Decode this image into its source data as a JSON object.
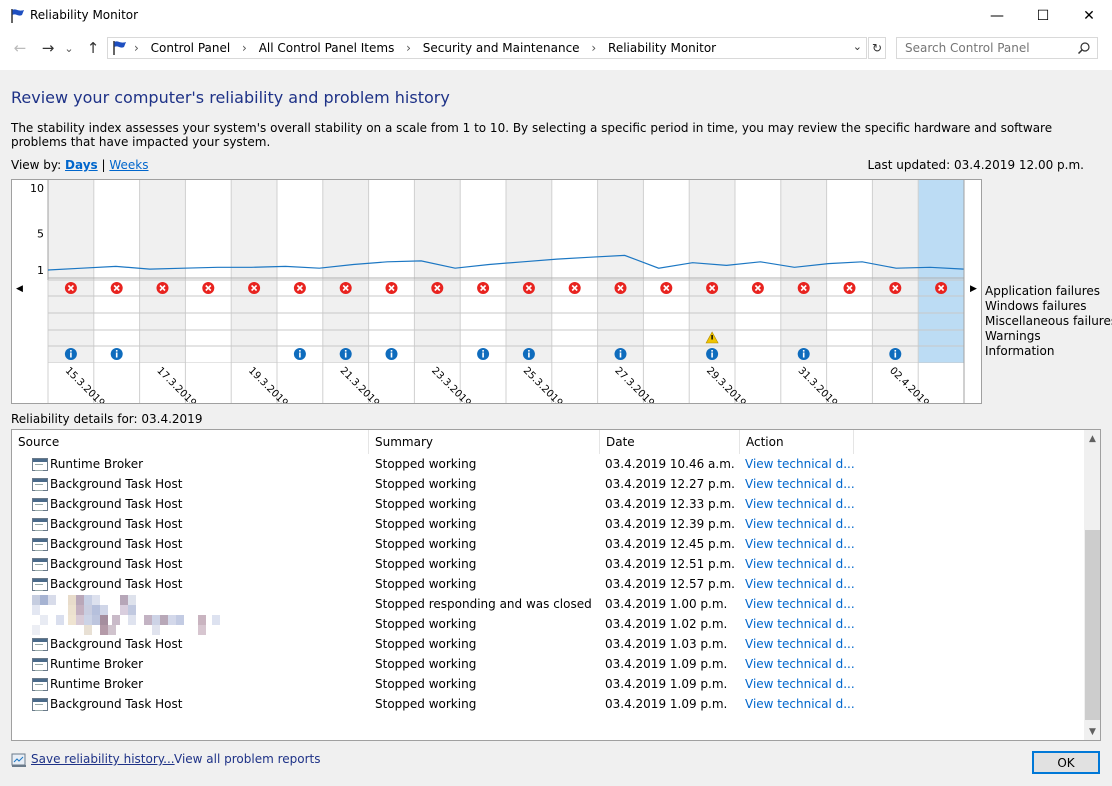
{
  "window": {
    "title": "Reliability Monitor",
    "minimize": "—",
    "maximize": "☐",
    "close": "✕"
  },
  "nav": {
    "back": "←",
    "forward": "→",
    "recent": "⌄",
    "up": "↑",
    "breadcrumbs": [
      "Control Panel",
      "All Control Panel Items",
      "Security and Maintenance",
      "Reliability Monitor"
    ],
    "separator": "›",
    "dropdown": "⌄",
    "refresh": "↻",
    "search_placeholder": "Search Control Panel"
  },
  "page": {
    "heading": "Review your computer's reliability and problem history",
    "description": "The stability index assesses your system's overall stability on a scale from 1 to 10. By selecting a specific period in time, you may review the specific hardware and software problems that have impacted your system.",
    "view_by_label": "View by:",
    "view_days": "Days",
    "view_sep": "|",
    "view_weeks": "Weeks",
    "last_updated": "Last updated: 03.4.2019 12.00 p.m."
  },
  "chart_data": {
    "type": "line",
    "y_ticks": [
      "10",
      "5",
      "1"
    ],
    "ylim": [
      1,
      10
    ],
    "columns": 20,
    "selected_column": 19,
    "x_labels": [
      "15.3.2019",
      "17.3.2019",
      "19.3.2019",
      "21.3.2019",
      "23.3.2019",
      "25.3.2019",
      "27.3.2019",
      "29.3.2019",
      "31.3.2019",
      "02.4.2019"
    ],
    "stability_index": [
      1.0,
      1.2,
      1.4,
      1.1,
      1.2,
      1.3,
      1.3,
      1.4,
      1.2,
      1.6,
      1.9,
      2.0,
      1.2,
      1.6,
      1.9,
      2.2,
      2.4,
      2.6,
      1.2,
      1.8,
      1.5,
      1.9,
      1.3,
      1.7,
      1.9,
      1.2,
      1.3,
      1.1
    ],
    "legend": [
      "Application failures",
      "Windows failures",
      "Miscellaneous failures",
      "Warnings",
      "Information"
    ],
    "application_failures": [
      1,
      1,
      1,
      1,
      1,
      1,
      1,
      1,
      1,
      1,
      1,
      1,
      1,
      1,
      1,
      1,
      1,
      1,
      1,
      1
    ],
    "warnings": [
      0,
      0,
      0,
      0,
      0,
      0,
      0,
      0,
      0,
      0,
      0,
      0,
      0,
      0,
      1,
      0,
      0,
      0,
      0,
      0
    ],
    "information": [
      1,
      1,
      0,
      0,
      0,
      1,
      1,
      1,
      0,
      1,
      1,
      0,
      1,
      0,
      1,
      0,
      1,
      0,
      1,
      0
    ],
    "scroll_left": "◀",
    "scroll_right": "▶"
  },
  "details": {
    "label": "Reliability details for: 03.4.2019",
    "columns": [
      "Source",
      "Summary",
      "Date",
      "Action"
    ],
    "sort_indicator": "^",
    "rows": [
      {
        "source": "Runtime Broker",
        "summary": "Stopped working",
        "date": "03.4.2019 10.46 a.m.",
        "action": "View  technical d..."
      },
      {
        "source": "Background Task Host",
        "summary": "Stopped working",
        "date": "03.4.2019 12.27 p.m.",
        "action": "View  technical d..."
      },
      {
        "source": "Background Task Host",
        "summary": "Stopped working",
        "date": "03.4.2019 12.33 p.m.",
        "action": "View  technical d..."
      },
      {
        "source": "Background Task Host",
        "summary": "Stopped working",
        "date": "03.4.2019 12.39 p.m.",
        "action": "View  technical d..."
      },
      {
        "source": "Background Task Host",
        "summary": "Stopped working",
        "date": "03.4.2019 12.45 p.m.",
        "action": "View  technical d..."
      },
      {
        "source": "Background Task Host",
        "summary": "Stopped working",
        "date": "03.4.2019 12.51 p.m.",
        "action": "View  technical d..."
      },
      {
        "source": "Background Task Host",
        "summary": "Stopped working",
        "date": "03.4.2019 12.57 p.m.",
        "action": "View  technical d..."
      },
      {
        "source": "",
        "summary": "Stopped responding and was closed",
        "date": "03.4.2019 1.00 p.m.",
        "action": "View  technical d..."
      },
      {
        "source": "",
        "summary": "Stopped working",
        "date": "03.4.2019 1.02 p.m.",
        "action": "View  technical d..."
      },
      {
        "source": "Background Task Host",
        "summary": "Stopped working",
        "date": "03.4.2019 1.03 p.m.",
        "action": "View  technical d..."
      },
      {
        "source": "Runtime Broker",
        "summary": "Stopped working",
        "date": "03.4.2019 1.09 p.m.",
        "action": "View  technical d..."
      },
      {
        "source": "Runtime Broker",
        "summary": "Stopped working",
        "date": "03.4.2019 1.09 p.m.",
        "action": "View  technical d..."
      },
      {
        "source": "Background Task Host",
        "summary": "Stopped working",
        "date": "03.4.2019 1.09 p.m.",
        "action": "View  technical d..."
      }
    ],
    "scroll_up": "▲",
    "scroll_down": "▼"
  },
  "footer": {
    "save_link": "Save reliability history...",
    "view_all_link": "View all problem reports",
    "ok": "OK"
  },
  "colors": {
    "heading": "#1e3287",
    "link": "#0066cc",
    "line": "#1c77c3",
    "selected": "#bcdcf4",
    "shaded": "#f0f0f0",
    "error": "#e8231f",
    "info": "#0f6cbd",
    "warning": "#f0c400"
  }
}
